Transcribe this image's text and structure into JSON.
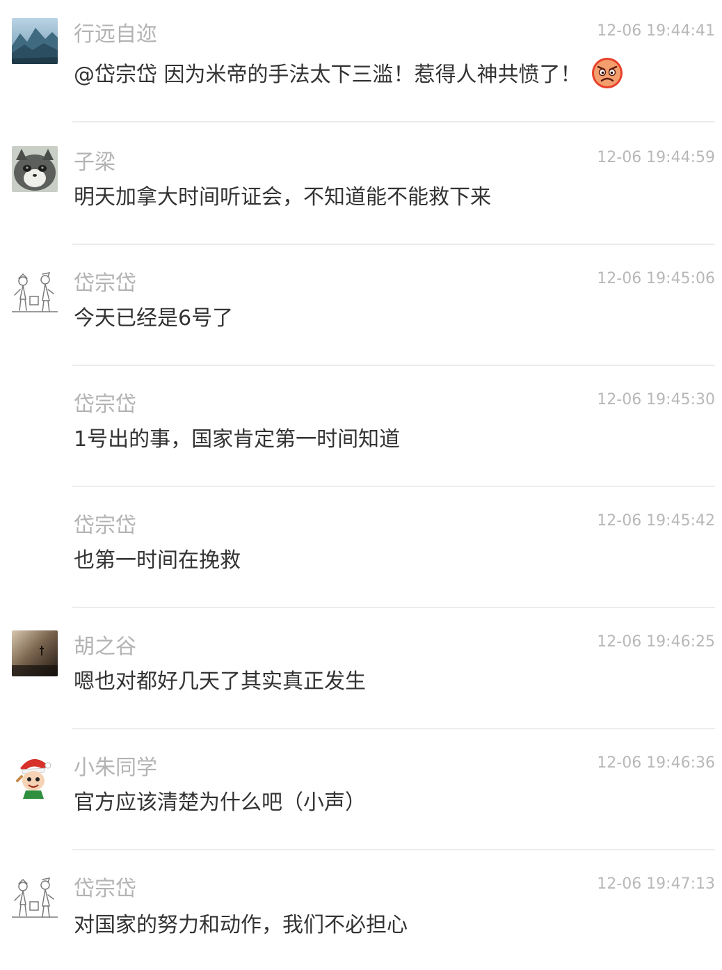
{
  "messages": [
    {
      "username": "行远自迩",
      "timestamp": "12-06 19:44:41",
      "content": "@岱宗岱 因为米帝的手法太下三滥！惹得人神共愤了！",
      "emoji": "angry-face-icon",
      "avatar": "mountain-landscape-avatar"
    },
    {
      "username": "子梁",
      "timestamp": "12-06 19:44:59",
      "content": "明天加拿大时间听证会，不知道能不能救下来",
      "avatar": "cat-avatar"
    },
    {
      "username": "岱宗岱",
      "timestamp": "12-06 19:45:06",
      "content": "今天已经是6号了",
      "avatar": "sketch-figures-avatar"
    },
    {
      "username": "岱宗岱",
      "timestamp": "12-06 19:45:30",
      "content": "1号出的事，国家肯定第一时间知道"
    },
    {
      "username": "岱宗岱",
      "timestamp": "12-06 19:45:42",
      "content": "也第一时间在挽救"
    },
    {
      "username": "胡之谷",
      "timestamp": "12-06 19:46:25",
      "content": "嗯也对都好几天了其实真正发生",
      "avatar": "dark-photo-avatar"
    },
    {
      "username": "小朱同学",
      "timestamp": "12-06 19:46:36",
      "content": "官方应该清楚为什么吧（小声）",
      "avatar": "cartoon-character-avatar"
    },
    {
      "username": "岱宗岱",
      "timestamp": "12-06 19:47:13",
      "content": "对国家的努力和动作，我们不必担心",
      "avatar": "sketch-figures-avatar"
    }
  ],
  "colors": {
    "username": "#b3b3b3",
    "timestamp": "#b8b8b8",
    "content": "#333333",
    "divider": "#ececec",
    "angry_emoji": "#e8402a"
  }
}
